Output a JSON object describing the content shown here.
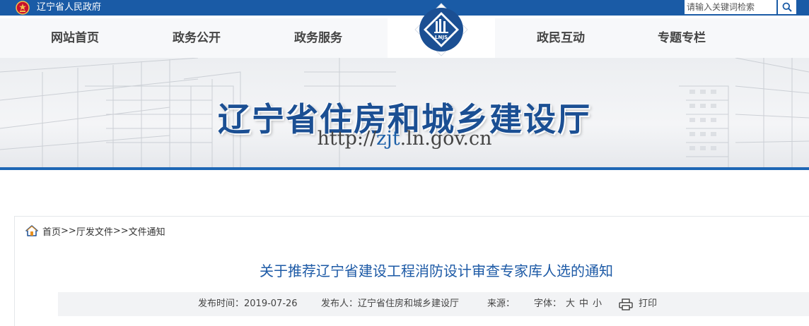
{
  "topbar": {
    "gov_name": "辽宁省人民政府",
    "search_placeholder": "请输入关键词检索",
    "bg_color": "#1a5ba6"
  },
  "nav": {
    "items": [
      {
        "label": "网站首页"
      },
      {
        "label": "政务公开"
      },
      {
        "label": "政务服务"
      },
      {
        "label": "政民互动"
      },
      {
        "label": "专题专栏"
      }
    ],
    "logo_text": "LNJS"
  },
  "banner": {
    "title": "辽宁省住房和城乡建设厅",
    "url_prefix": "http://",
    "url_highlight": "zjt",
    "url_suffix": ".ln.gov.cn"
  },
  "breadcrumb": {
    "home": "首页",
    "sep1": ">>",
    "section": "厅发文件",
    "sep2": ">>",
    "current": "文件通知"
  },
  "article": {
    "title": "关于推荐辽宁省建设工程消防设计审查专家库人选的通知",
    "publish_time": "发布时间：2019-07-26",
    "publisher": "发布人：辽宁省住房和城乡建设厅",
    "source": "来源：",
    "font_label": "字体：",
    "font_large": "大",
    "font_medium": "中",
    "font_small": "小",
    "print": "打印"
  },
  "colors": {
    "accent": "#1d5aa6",
    "stripe": "#1e67b5"
  }
}
